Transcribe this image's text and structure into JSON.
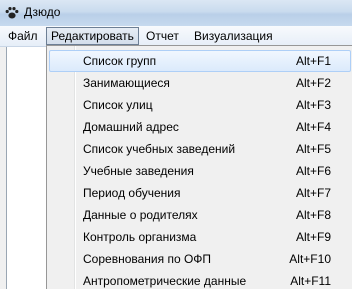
{
  "window": {
    "title": "Дзюдо",
    "icon": "paw-icon"
  },
  "menubar": {
    "items": [
      {
        "label": "Файл"
      },
      {
        "label": "Редактировать"
      },
      {
        "label": "Отчет"
      },
      {
        "label": "Визуализация"
      }
    ],
    "active_index": 1
  },
  "dropdown": {
    "items": [
      {
        "label": "Список групп",
        "shortcut": "Alt+F1"
      },
      {
        "label": "Занимающиеся",
        "shortcut": "Alt+F2"
      },
      {
        "label": "Список улиц",
        "shortcut": "Alt+F3"
      },
      {
        "label": "Домашний адрес",
        "shortcut": "Alt+F4"
      },
      {
        "label": "Список учебных заведений",
        "shortcut": "Alt+F5"
      },
      {
        "label": "Учебные заведения",
        "shortcut": "Alt+F6"
      },
      {
        "label": "Период обучения",
        "shortcut": "Alt+F7"
      },
      {
        "label": "Данные о родителях",
        "shortcut": "Alt+F8"
      },
      {
        "label": "Контроль организма",
        "shortcut": "Alt+F9"
      },
      {
        "label": "Соревнования по ОФП",
        "shortcut": "Alt+F10"
      },
      {
        "label": "Антропометрические данные",
        "shortcut": "Alt+F11"
      }
    ],
    "highlighted_index": 0
  }
}
